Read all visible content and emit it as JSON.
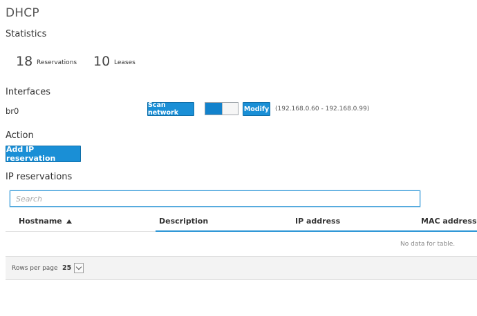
{
  "page": {
    "title": "DHCP"
  },
  "statistics": {
    "heading": "Statistics",
    "reservations": {
      "value": "18",
      "label": "Reservations"
    },
    "leases": {
      "value": "10",
      "label": "Leases"
    }
  },
  "interfaces": {
    "heading": "Interfaces",
    "items": [
      {
        "name": "br0",
        "scan_label": "Scan network",
        "enabled": true,
        "modify_label": "Modify",
        "range": "(192.168.0.60 - 192.168.0.99)"
      }
    ]
  },
  "action": {
    "heading": "Action",
    "add_label": "Add IP reservation"
  },
  "reservations": {
    "heading": "IP reservations",
    "search": {
      "placeholder": "Search",
      "value": ""
    },
    "columns": [
      "Hostname",
      "Description",
      "IP address",
      "MAC address"
    ],
    "sort": {
      "column": "Hostname",
      "direction": "ascending"
    },
    "rows": [],
    "empty_text": "No data for table.",
    "pagination": {
      "rows_per_page_label": "Rows per page",
      "rows_per_page": "25"
    }
  },
  "colors": {
    "accent": "#1a8fd6",
    "toggle_on": "#1282cc",
    "search_border": "#2b95d6"
  },
  "icons": {
    "sort": "sort-ascending-icon",
    "dropdown": "chevron-down-icon"
  }
}
